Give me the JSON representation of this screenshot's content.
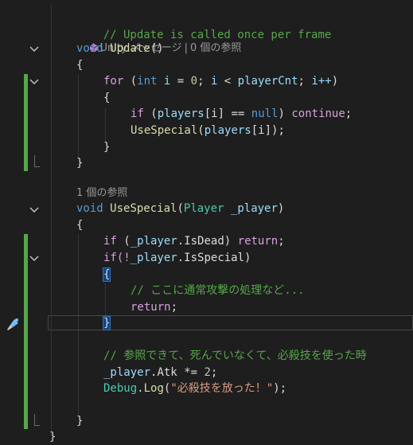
{
  "code": {
    "comment_update": "// Update is called once per frame",
    "codelens_update_unity": "Unity メッセージ",
    "codelens_update_sep": "|",
    "codelens_update_refs": "0 個の参照",
    "kw_void": "void",
    "fn_update": "Update",
    "paren_empty": "()",
    "brace_open": "{",
    "brace_close": "}",
    "kw_for": "for",
    "kw_int": "int",
    "var_i": "i",
    "op_assign": " = ",
    "num_0": "0",
    "semi_sp": "; ",
    "op_lt": " < ",
    "var_playerCnt": "playerCnt",
    "inc": "i++",
    "paren_open": "(",
    "paren_close": ")",
    "kw_if": "if",
    "var_players": "players",
    "idx_i": "[i]",
    "op_eq": " == ",
    "kw_null": "null",
    "kw_continue": "continue",
    "semi": ";",
    "fn_usespecial": "UseSpecial",
    "codelens_usespecial_refs": "1 個の参照",
    "type_player": "Player",
    "param_player": "_player",
    "prop_isdead": "IsDead",
    "kw_return": "return",
    "if_not": "if(!",
    "prop_isspecial": "IsSpecial",
    "comment_normal_attack": "// ここに通常攻撃の処理など...",
    "comment_special": "// 参照できて、死んでいなくて、必殺技を使った時",
    "prop_atk": "Atk",
    "op_muleq": " *= ",
    "num_2": "2",
    "type_debug": "Debug",
    "fn_log": "Log",
    "str_special_fired": "\"必殺技を放った！\"",
    "dot": "."
  },
  "colors": {
    "background": "#1e1e1e",
    "comment": "#57a64a",
    "keyword": "#569cd6",
    "control_keyword": "#d8a0df",
    "type": "#4ec9b0",
    "method": "#dcdcaa",
    "variable": "#9cdcfe",
    "number": "#b5cea8",
    "string": "#d69d85",
    "change_bar": "#57a64a"
  }
}
